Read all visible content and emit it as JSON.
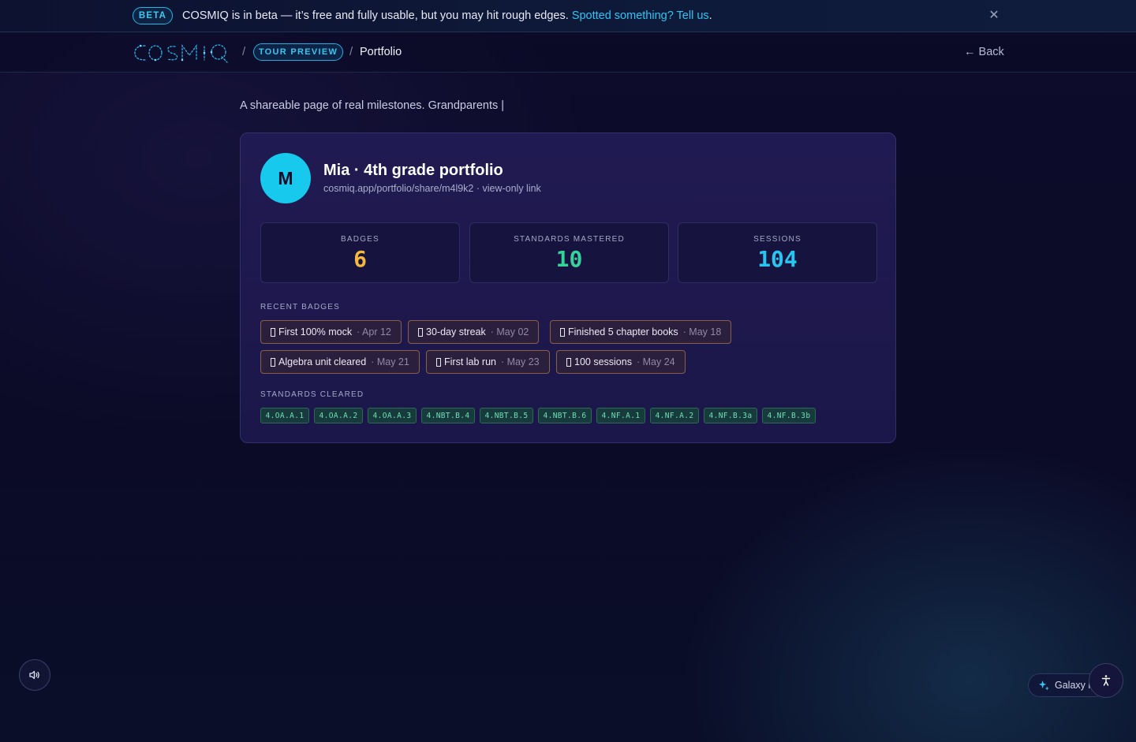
{
  "beta_banner": {
    "badge": "BETA",
    "message": "COSMIQ is in beta — it’s free and fully usable, but you may hit rough edges.",
    "link_text": "Spotted something? Tell us",
    "period": ".",
    "close_icon": "close-icon"
  },
  "nav": {
    "logo": "COSMIQ",
    "separator": "/",
    "tour_badge": "TOUR PREVIEW",
    "current_page": "Portfolio",
    "back_label": "← Back"
  },
  "intro": "A shareable page of real milestones. Grandparents |",
  "profile": {
    "initial": "M",
    "title": "Mia · 4th grade portfolio",
    "share_link": "cosmiq.app/portfolio/share/m4l9k2 · view-only link"
  },
  "stats": [
    {
      "label": "BADGES",
      "value": "6",
      "color": "#f5b83c"
    },
    {
      "label": "STANDARDS MASTERED",
      "value": "10",
      "color": "#34d39a"
    },
    {
      "label": "SESSIONS",
      "value": "104",
      "color": "#27c6f0"
    }
  ],
  "recent_badges": {
    "label": "RECENT BADGES",
    "items": [
      {
        "name": "First 100% mock",
        "date": "· Apr 12"
      },
      {
        "name": "30-day streak",
        "date": "· May 02"
      },
      {
        "name": "Finished 5 chapter books",
        "date": "· May 18"
      },
      {
        "name": "Algebra unit cleared",
        "date": "· May 21"
      },
      {
        "name": "First lab run",
        "date": "· May 23"
      },
      {
        "name": "100 sessions",
        "date": "· May 24"
      }
    ]
  },
  "standards": {
    "label": "STANDARDS CLEARED",
    "items": [
      "4.OA.A.1",
      "4.OA.A.2",
      "4.OA.A.3",
      "4.NBT.B.4",
      "4.NBT.B.5",
      "4.NBT.B.6",
      "4.NF.A.1",
      "4.NF.A.2",
      "4.NF.B.3a",
      "4.NF.B.3b"
    ]
  },
  "floating": {
    "sound_icon": "speaker-icon",
    "galaxy_label": "Galaxy m",
    "galaxy_icon": "sparkles-icon",
    "a11y_icon": "accessibility-icon"
  }
}
